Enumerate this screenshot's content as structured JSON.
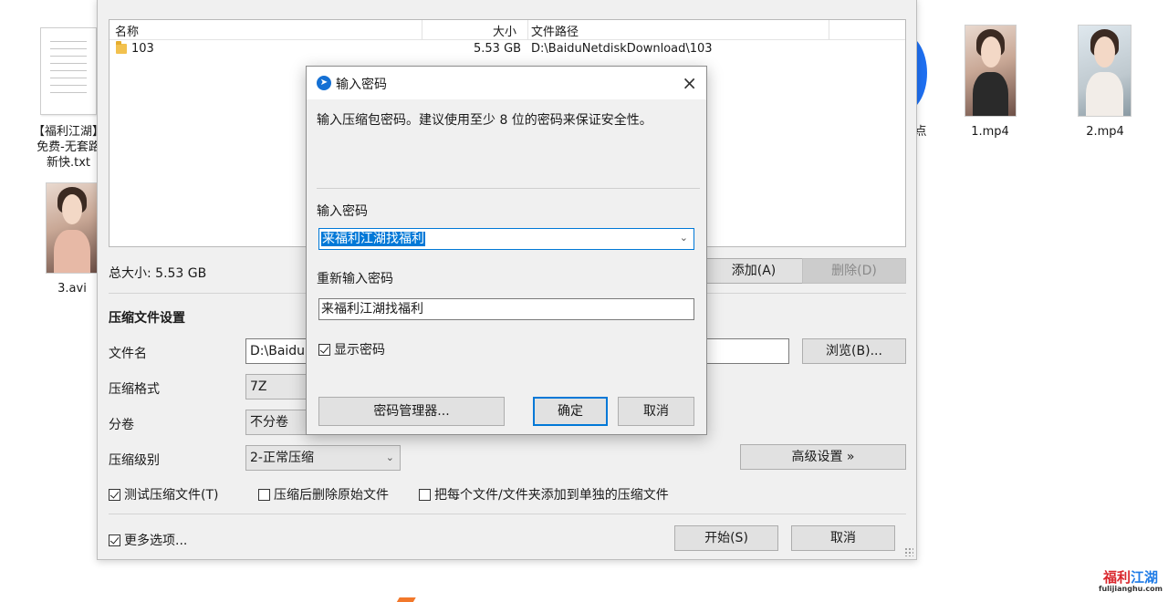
{
  "desktop": {
    "txt_file_label_lines": [
      "【福利江湖】",
      "免费-无套路",
      "新快.txt"
    ],
    "avi_label": "3.avi",
    "mp4_1_label": "1.mp4",
    "mp4_2_label": "2.mp4",
    "partial_label": "点"
  },
  "compress_window": {
    "file_list": {
      "columns": {
        "name": "名称",
        "size": "大小",
        "path": "文件路径"
      },
      "rows": [
        {
          "name": "103",
          "size": "5.53 GB",
          "path": "D:\\BaiduNetdiskDownload\\103"
        }
      ]
    },
    "total_size": "总大小: 5.53 GB",
    "add_button": "添加(A)",
    "delete_button": "删除(D)",
    "settings_heading": "压缩文件设置",
    "filename_label": "文件名",
    "filename_value": "D:\\BaiduI",
    "browse_button": "浏览(B)...",
    "format_label": "压缩格式",
    "format_value": "7Z",
    "split_label": "分卷",
    "split_value": "不分卷",
    "level_label": "压缩级别",
    "level_value": "2-正常压缩",
    "advanced_button": "高级设置 »",
    "test_check": "测试压缩文件(T)",
    "test_checked": true,
    "delete_after_check": "压缩后删除原始文件",
    "delete_after_checked": false,
    "separate_check": "把每个文件/文件夹添加到单独的压缩文件",
    "separate_checked": false,
    "more_options_check": "更多选项...",
    "more_options_checked": true,
    "start_button": "开始(S)",
    "cancel_button": "取消"
  },
  "password_dialog": {
    "title": "输入密码",
    "hint": "输入压缩包密码。建议使用至少 8 位的密码来保证安全性。",
    "password_label": "输入密码",
    "password_value": "来福利江湖找福利",
    "reenter_label": "重新输入密码",
    "reenter_value": "来福利江湖找福利",
    "show_password_check": "显示密码",
    "show_password_checked": true,
    "manager_button": "密码管理器...",
    "ok_button": "确定",
    "cancel_button": "取消"
  },
  "watermark": {
    "main_left": "福利",
    "main_right": "江湖",
    "sub": "fulijianghu.com"
  },
  "colors": {
    "accent": "#0078d7",
    "dialog_bg": "#f0f0f0",
    "watermark_red": "#d9262c",
    "watermark_blue": "#1e7be6"
  }
}
